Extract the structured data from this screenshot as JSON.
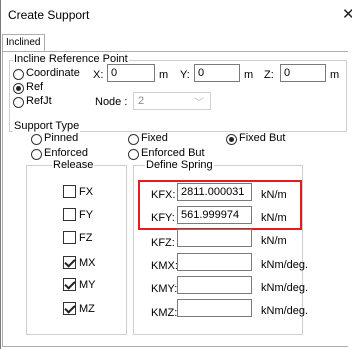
{
  "window": {
    "title": "Create Support",
    "close_glyph": "✕"
  },
  "tab": {
    "label": "Inclined"
  },
  "incline_ref": {
    "group_title": "Incline Reference Point",
    "options": [
      {
        "label": "Coordinate",
        "checked": false
      },
      {
        "label": "Ref",
        "checked": true
      },
      {
        "label": "RefJt",
        "checked": false
      }
    ],
    "x_label": "X:",
    "x_value": "0",
    "x_unit": "m",
    "y_label": "Y:",
    "y_value": "0",
    "y_unit": "m",
    "z_label": "Z:",
    "z_value": "0",
    "z_unit": "m",
    "node_label": "Node :",
    "node_value": "2"
  },
  "support_type": {
    "group_title": "Support Type",
    "options": [
      {
        "label": "Pinned",
        "checked": false
      },
      {
        "label": "Fixed",
        "checked": false
      },
      {
        "label": "Fixed But",
        "checked": true
      },
      {
        "label": "Enforced",
        "checked": false
      },
      {
        "label": "Enforced But",
        "checked": false
      }
    ]
  },
  "release": {
    "title": "Release",
    "items": [
      {
        "label": "FX",
        "checked": false
      },
      {
        "label": "FY",
        "checked": false
      },
      {
        "label": "FZ",
        "checked": false
      },
      {
        "label": "MX",
        "checked": true
      },
      {
        "label": "MY",
        "checked": true
      },
      {
        "label": "MZ",
        "checked": true
      }
    ]
  },
  "spring": {
    "group_title": "Define Spring",
    "rows": [
      {
        "label": "KFX:",
        "value": "2811.000031",
        "unit": "kN/m"
      },
      {
        "label": "KFY:",
        "value": "561.999974",
        "unit": "kN/m"
      },
      {
        "label": "KFZ:",
        "value": "",
        "unit": "kN/m"
      },
      {
        "label": "KMX:",
        "value": "",
        "unit": "kNm/deg."
      },
      {
        "label": "KMY:",
        "value": "",
        "unit": "kNm/deg."
      },
      {
        "label": "KMZ:",
        "value": "",
        "unit": "kNm/deg."
      }
    ]
  },
  "colors": {
    "highlight": "#e21d1d",
    "border": "#adadad"
  }
}
